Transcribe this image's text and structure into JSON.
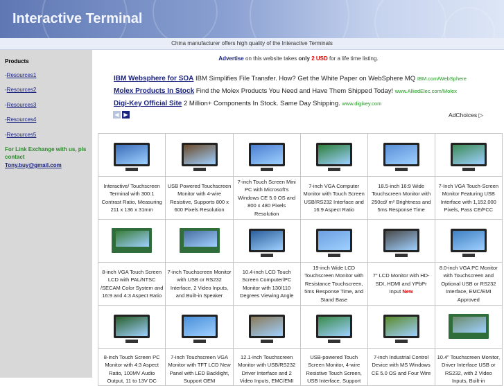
{
  "header": {
    "title": "Interactive Terminal"
  },
  "tagline": "China manufacturer offers high quality of the Interactive Terminals",
  "sidebar": {
    "heading": "Products",
    "items": [
      {
        "prefix": "-",
        "label": "Resources1"
      },
      {
        "prefix": "-",
        "label": "Resources2"
      },
      {
        "prefix": "-",
        "label": "Resources3"
      },
      {
        "prefix": "-",
        "label": "Resources4"
      },
      {
        "prefix": "-",
        "label": "Resources5"
      }
    ],
    "promo": "For Link Exchange with us, pls contact",
    "email": "Tony.buy@gmail.com"
  },
  "advertise": {
    "link": "Advertise",
    "text1": "on this website takes",
    "only": "only",
    "price": "2 USD",
    "text2": "for a life time listing."
  },
  "ads": [
    {
      "link": "IBM Websphere for SOA",
      "desc": "IBM Simplifies File Transfer. How? Get the White Paper on WebSphere MQ",
      "url": "IBM.com/WebSphere"
    },
    {
      "link": "Molex Products In Stock",
      "desc": "Find the Molex Products You Need and Have Them Shipped Today!",
      "url": "www.AlliedElec.com/Molex"
    },
    {
      "link": "Digi-Key Official Site",
      "desc": "2 Million+ Components In Stock. Same Day Shipping.",
      "url": "www.digikey.com"
    }
  ],
  "ad_nav": {
    "prev_icon": "◀",
    "next_icon": "▶"
  },
  "adchoices": "AdChoices ▷",
  "products": [
    {
      "desc": "Interactive/ Touchscreen Terminal with 300:1 Contrast Ratio, Measuring 211 x 136 x 31mm",
      "icon": "monitor"
    },
    {
      "desc": "USB Powered Touchscreen Monitor with 4-wire Resistive, Supports 800 x 600 Pixels Resolution",
      "icon": "monitor"
    },
    {
      "desc": "7-inch Touch Screen Mini PC with Microsoft's Windows CE 5.0 OS and 800 x 480 Pixels Resolution",
      "icon": "monitor"
    },
    {
      "desc": "7-inch VGA Computer Monitor with Touch Screen USB/RS232 Interface and 16:9 Aspect Ratio",
      "icon": "monitor"
    },
    {
      "desc": "18.5-inch 16:9 Wide Touchscreen Monitor with 250cd/ m&#178; Brightness and 5ms Response Time",
      "icon": "monitor"
    },
    {
      "desc": "7-Inch VGA Touch-Screen Monitor Featuring USB Interface with 1,152,000 Pixels, Pass CE/FCC",
      "icon": "monitor"
    },
    {
      "desc": "8-inch VGA Touch Screen LCD with PAL/NTSC /SECAM Color System and 16:9 and 4:3 Aspect Ratio",
      "icon": "panel"
    },
    {
      "desc": "7-inch Touchscreen Monitor with USB or RS232 Interface, 2 Video Inputs, and Built-in Speaker",
      "icon": "panel"
    },
    {
      "desc": "10.4-inch LCD Touch Screen Computer/PC Monitor with 130/110 Degrees Viewing Angle",
      "icon": "monitor"
    },
    {
      "desc": "19-inch Wide LCD Touchscreen Monitor with Resistance Touchscreen, 5ms Response Time, and Stand Base",
      "icon": "monitor"
    },
    {
      "desc": "7\" LCD Monitor with HD-SDI, HDMI and YPbPr Input",
      "new": "New",
      "icon": "monitor"
    },
    {
      "desc": "8.0-inch VGA PC Monitor with Touchscreen and Optional USB or RS232 Interface, EMC/EMI Approved",
      "icon": "monitor"
    },
    {
      "desc": "8-inch Touch Screen PC Monitor with 4:3 Aspect Ratio, 100MV Audio Output, 11 to 13V DC",
      "icon": "monitor"
    },
    {
      "desc": "7-inch Touchscreen VGA Monitor with TFT LCD New Panel with LED Backlight, Support OEM",
      "icon": "monitor"
    },
    {
      "desc": "12.1-inch Touchscreen Monitor with USB/RS232 Driver Interface and 2 Video Inputs, EMC/EMI",
      "icon": "monitor"
    },
    {
      "desc": "USB-powered Touch Screen Monitor, 4-wire Resistive Touch Screen, USB Interface, Support",
      "icon": "monitor"
    },
    {
      "desc": "7-inch Industrial Control Device with MS Windows CE 5.0 OS and Four Wire",
      "icon": "monitor"
    },
    {
      "desc": "10.4\" Touchscreen Monitor, Driver Interface USB or RS232, with 2 Video Inputs, Built-in",
      "icon": "panel"
    }
  ],
  "colors": {
    "header_start": "#5f78b4",
    "header_end": "#dde6f6",
    "sidebar_bg": "#d8d8d8",
    "link": "#1a237e",
    "promo": "#2a8a2a",
    "price": "#dd0000",
    "ad_url": "#1a9a1a"
  }
}
